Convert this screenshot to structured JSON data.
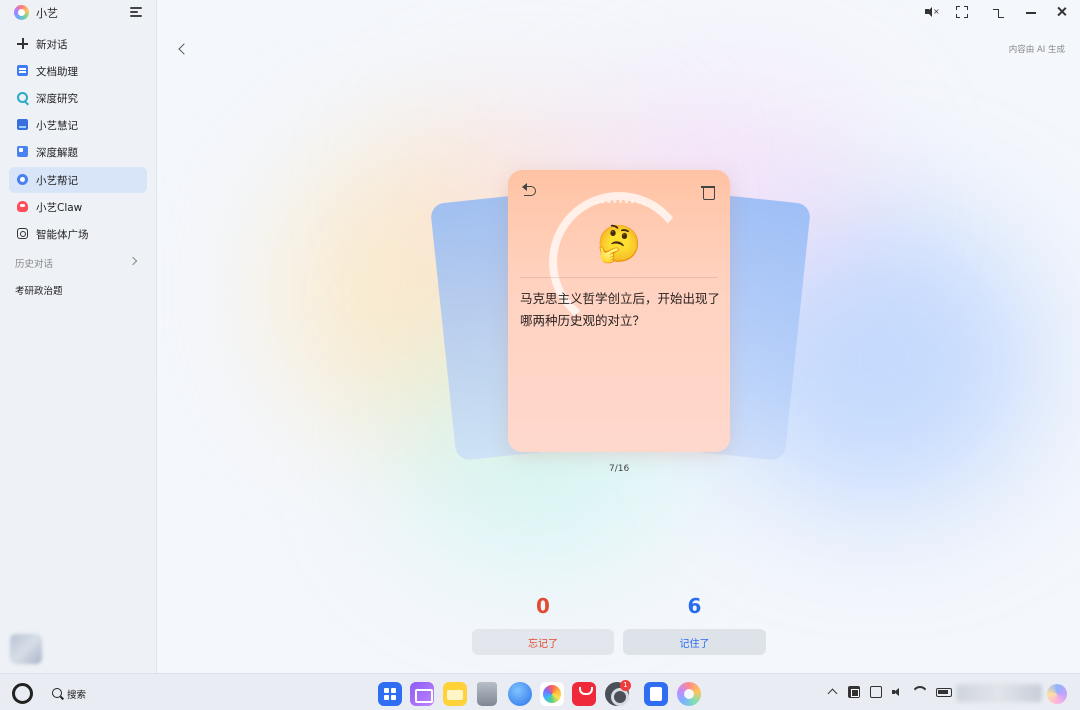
{
  "app": {
    "name": "小艺"
  },
  "sidebar": {
    "items": [
      {
        "label": "新对话",
        "icon": "plus-icon"
      },
      {
        "label": "文档助理",
        "icon": "document-icon"
      },
      {
        "label": "深度研究",
        "icon": "research-icon"
      },
      {
        "label": "小艺慧记",
        "icon": "note-icon"
      },
      {
        "label": "深度解题",
        "icon": "solve-icon"
      },
      {
        "label": "小艺帮记",
        "icon": "memory-icon",
        "active": true
      },
      {
        "label": "小艺Claw",
        "icon": "claw-icon"
      },
      {
        "label": "智能体广场",
        "icon": "agent-plaza-icon"
      }
    ],
    "history_label": "历史对话",
    "history_items": [
      "考研政治题"
    ]
  },
  "header": {
    "ai_note": "内容由 AI 生成"
  },
  "window_controls": {
    "mute_glyph": "×"
  },
  "card": {
    "emoji": "🤔",
    "question": "马克思主义哲学创立后，开始出现了哪两种历史观的对立？",
    "progress": "7/16"
  },
  "stats": {
    "forgot_count": "0",
    "forgot_label": "忘记了",
    "remembered_count": "6",
    "remembered_label": "记住了"
  },
  "taskbar": {
    "search_label": "搜索",
    "settings_badge": "1"
  },
  "colors": {
    "forgot": "#e14b33",
    "remembered": "#2a6cf0",
    "active_nav": "#d8e4f8",
    "card_top": "#ffc3a4",
    "card_bottom": "#ffd8cd"
  }
}
